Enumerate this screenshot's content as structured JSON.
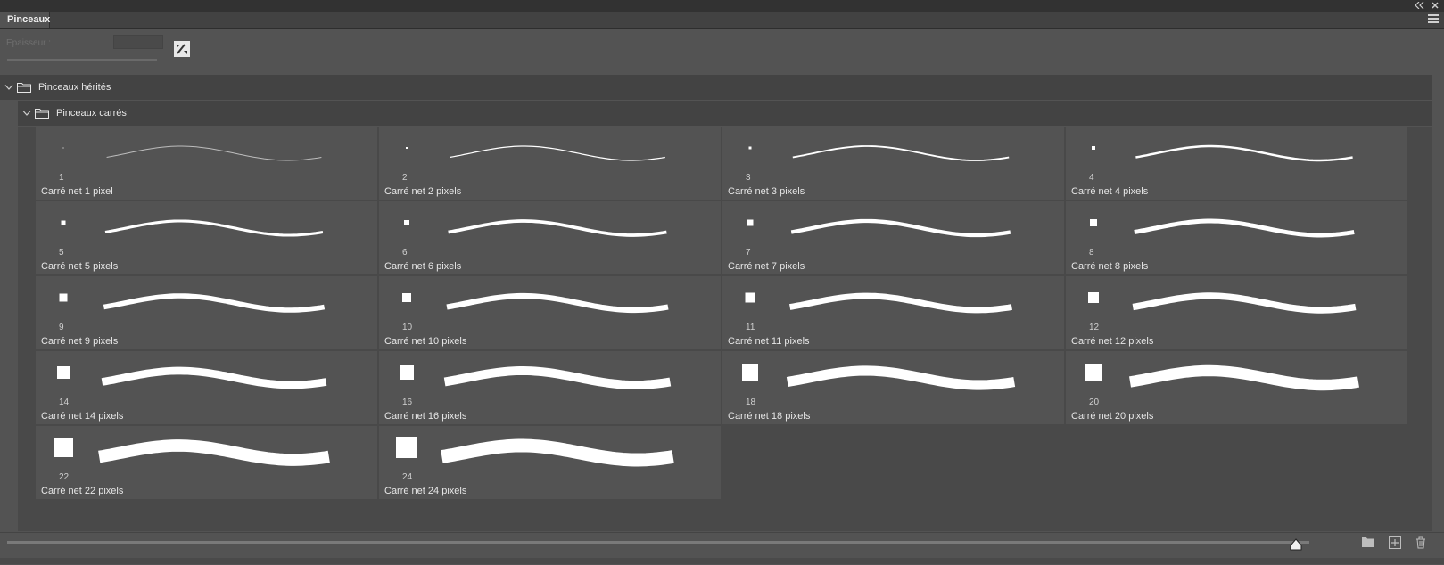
{
  "panel": {
    "tab_label": "Pinceaux",
    "thickness_label": "Epaisseur :"
  },
  "groups": [
    {
      "label": "Pinceaux hérités"
    },
    {
      "label": "Pinceaux carrés"
    }
  ],
  "brushes": [
    {
      "size": 1,
      "label": "1",
      "name": "Carré net 1 pixel"
    },
    {
      "size": 2,
      "label": "2",
      "name": "Carré net 2 pixels"
    },
    {
      "size": 3,
      "label": "3",
      "name": "Carré net 3 pixels"
    },
    {
      "size": 4,
      "label": "4",
      "name": "Carré net 4 pixels"
    },
    {
      "size": 5,
      "label": "5",
      "name": "Carré net 5 pixels"
    },
    {
      "size": 6,
      "label": "6",
      "name": "Carré net 6 pixels"
    },
    {
      "size": 7,
      "label": "7",
      "name": "Carré net 7 pixels"
    },
    {
      "size": 8,
      "label": "8",
      "name": "Carré net 8 pixels"
    },
    {
      "size": 9,
      "label": "9",
      "name": "Carré net 9 pixels"
    },
    {
      "size": 10,
      "label": "10",
      "name": "Carré net 10 pixels"
    },
    {
      "size": 11,
      "label": "11",
      "name": "Carré net 11 pixels"
    },
    {
      "size": 12,
      "label": "12",
      "name": "Carré net 12 pixels"
    },
    {
      "size": 14,
      "label": "14",
      "name": "Carré net 14 pixels"
    },
    {
      "size": 16,
      "label": "16",
      "name": "Carré net 16 pixels"
    },
    {
      "size": 18,
      "label": "18",
      "name": "Carré net 18 pixels"
    },
    {
      "size": 20,
      "label": "20",
      "name": "Carré net 20 pixels"
    },
    {
      "size": 22,
      "label": "22",
      "name": "Carré net 22 pixels"
    },
    {
      "size": 24,
      "label": "24",
      "name": "Carré net 24 pixels"
    }
  ],
  "preview_size_level": 0.99,
  "icons": {
    "collapse": "double-chevron-left-icon",
    "close": "close-icon",
    "menu": "hamburger-menu-icon",
    "edit": "brush-settings-icon",
    "new_group": "folder-icon",
    "new_brush": "add-brush-icon",
    "delete": "trash-icon"
  },
  "colors": {
    "panel_bg": "#535353",
    "group_row_bg": "#434343",
    "stroke": "#ffffff"
  }
}
